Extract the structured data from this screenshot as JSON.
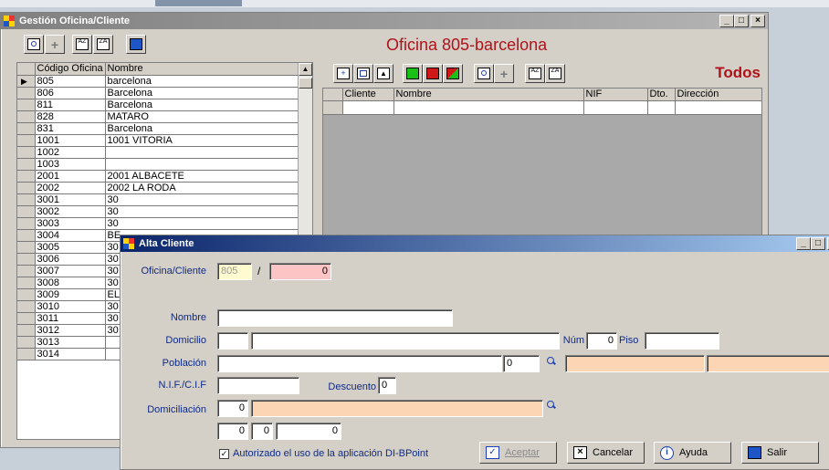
{
  "main_window": {
    "title": "Gestión Oficina/Cliente",
    "office_header": "Oficina 805-barcelona",
    "filter_label": "Todos",
    "office_table": {
      "columns": [
        "Código Oficina",
        "Nombre"
      ],
      "rows": [
        [
          "805",
          "barcelona"
        ],
        [
          "806",
          "Barcelona"
        ],
        [
          "811",
          "Barcelona"
        ],
        [
          "828",
          "MATARO"
        ],
        [
          "831",
          "Barcelona"
        ],
        [
          "1001",
          "1001 VITORIA"
        ],
        [
          "1002",
          ""
        ],
        [
          "1003",
          ""
        ],
        [
          "2001",
          "2001 ALBACETE"
        ],
        [
          "2002",
          "2002 LA RODA"
        ],
        [
          "3001",
          "30"
        ],
        [
          "3002",
          "30"
        ],
        [
          "3003",
          "30"
        ],
        [
          "3004",
          "BE"
        ],
        [
          "3005",
          "30"
        ],
        [
          "3006",
          "30"
        ],
        [
          "3007",
          "30"
        ],
        [
          "3008",
          "30"
        ],
        [
          "3009",
          "EL"
        ],
        [
          "3010",
          "30"
        ],
        [
          "3011",
          "30"
        ],
        [
          "3012",
          "30"
        ],
        [
          "3013",
          ""
        ],
        [
          "3014",
          ""
        ]
      ]
    },
    "client_table": {
      "columns": [
        "Cliente",
        "Nombre",
        "NIF",
        "Dto.",
        "Dirección"
      ]
    }
  },
  "dialog": {
    "title": "Alta Cliente",
    "oficina_label": "Oficina/Cliente",
    "oficina_value": "805",
    "separator": "/",
    "cliente_value": "0",
    "nombre_label": "Nombre",
    "domicilio_label": "Domicilio",
    "num_label": "Núm",
    "num_value": "0",
    "piso_label": "Piso",
    "poblacion_label": "Población",
    "poblacion_code": "0",
    "nif_label": "N.I.F./C.I.F",
    "descuento_label": "Descuento",
    "descuento_value": "0",
    "domiciliacion_label": "Domiciliación",
    "domiciliacion_code": "0",
    "bank_1": "0",
    "bank_2": "0",
    "bank_3": "0",
    "checkbox_label": "Autorizado el uso de la aplicación DI-BPoint",
    "accept_label": "Aceptar",
    "cancel_label": "Cancelar",
    "help_label": "Ayuda",
    "exit_label": "Salir"
  },
  "colors": {
    "label_blue": "#0e2a88",
    "header_red": "#b0121a",
    "peach": "#fcd6b4",
    "pink": "#fcc4c4"
  }
}
